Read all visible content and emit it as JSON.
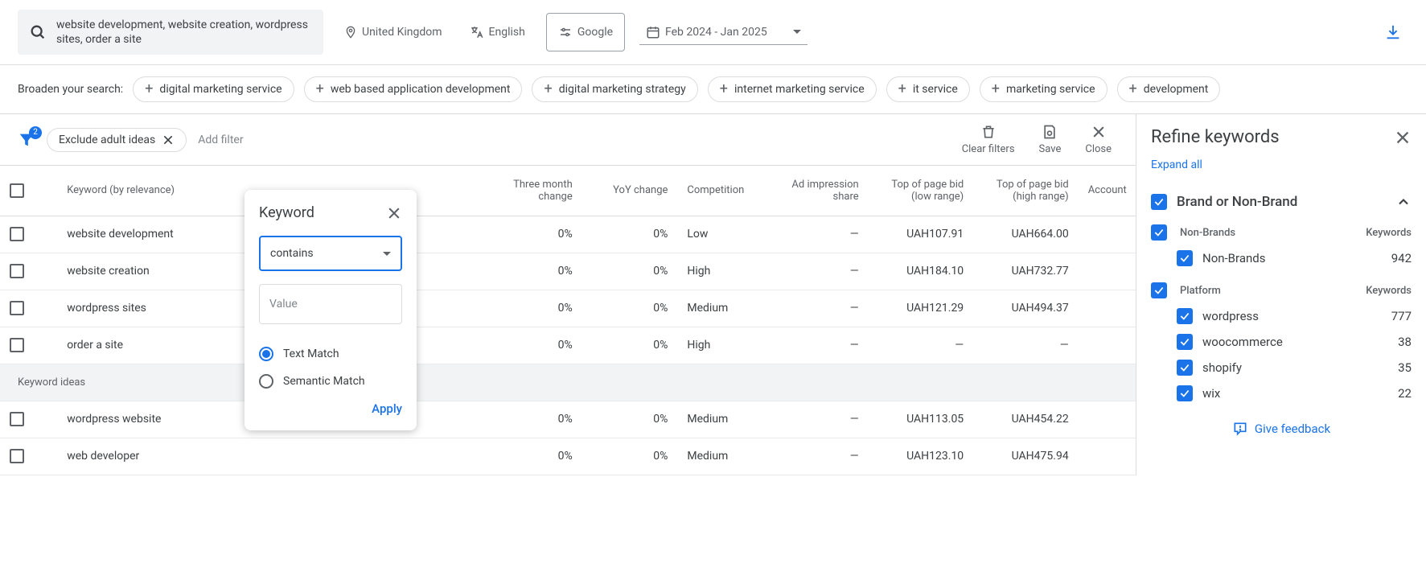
{
  "topbar": {
    "search_text": "website development, website creation, wordpress sites, order a site",
    "location": "United Kingdom",
    "language": "English",
    "network": "Google",
    "daterange": "Feb 2024 - Jan 2025"
  },
  "broaden": {
    "label": "Broaden your search:",
    "chips": [
      "digital marketing service",
      "web based application development",
      "digital marketing strategy",
      "internet marketing service",
      "it service",
      "marketing service",
      "development"
    ]
  },
  "filters": {
    "badge": "2",
    "active_pill": "Exclude adult ideas",
    "add_filter": "Add filter",
    "clear": "Clear filters",
    "save": "Save",
    "close": "Close"
  },
  "popover": {
    "title": "Keyword",
    "operator": "contains",
    "value_placeholder": "Value",
    "radio_text": "Text Match",
    "radio_semantic": "Semantic Match",
    "apply": "Apply"
  },
  "columns": {
    "keyword": "Keyword (by relevance)",
    "three_month": "Three month change",
    "yoy": "YoY change",
    "competition": "Competition",
    "ad_impression": "Ad impression share",
    "low": "Top of page bid (low range)",
    "high": "Top of page bid (high range)",
    "account": "Account"
  },
  "rows": [
    {
      "kw": "website development",
      "tm": "0%",
      "yoy": "0%",
      "comp": "Low",
      "ad": "—",
      "low": "UAH107.91",
      "high": "UAH664.00"
    },
    {
      "kw": "website creation",
      "tm": "0%",
      "yoy": "0%",
      "comp": "High",
      "ad": "—",
      "low": "UAH184.10",
      "high": "UAH732.77"
    },
    {
      "kw": "wordpress sites",
      "tm": "0%",
      "yoy": "0%",
      "comp": "Medium",
      "ad": "—",
      "low": "UAH121.29",
      "high": "UAH494.37"
    },
    {
      "kw": "order a site",
      "tm": "0%",
      "yoy": "0%",
      "comp": "High",
      "ad": "—",
      "low": "—",
      "high": "—"
    }
  ],
  "ideas_label": "Keyword ideas",
  "idea_rows": [
    {
      "kw": "wordpress website",
      "tm": "0%",
      "yoy": "0%",
      "comp": "Medium",
      "ad": "—",
      "low": "UAH113.05",
      "high": "UAH454.22"
    },
    {
      "kw": "web developer",
      "tm": "0%",
      "yoy": "0%",
      "comp": "Medium",
      "ad": "—",
      "low": "UAH123.10",
      "high": "UAH475.94"
    }
  ],
  "refine": {
    "title": "Refine keywords",
    "expand": "Expand all",
    "brand_section": "Brand or Non-Brand",
    "nonbrands_hdr": "Non-Brands",
    "keywords_hdr": "Keywords",
    "nonbrands_item": "Non-Brands",
    "nonbrands_count": "942",
    "platform_hdr": "Platform",
    "platforms": [
      {
        "name": "wordpress",
        "count": "777"
      },
      {
        "name": "woocommerce",
        "count": "38"
      },
      {
        "name": "shopify",
        "count": "35"
      },
      {
        "name": "wix",
        "count": "22"
      }
    ],
    "feedback": "Give feedback"
  }
}
